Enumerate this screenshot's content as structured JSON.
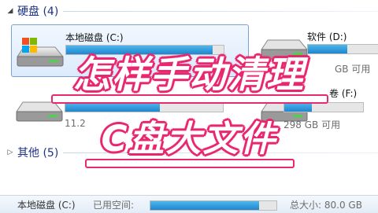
{
  "groups": {
    "hard_disks": {
      "label": "硬盘 (4)"
    },
    "other": {
      "label": "其他 (5)"
    }
  },
  "drives": [
    {
      "name": "本地磁盘 (C:)",
      "free_text": "11.2",
      "used_fraction": 0.93,
      "selected": true
    },
    {
      "name": "软件 (D:)",
      "free_text": "GB 可用",
      "used_fraction": 0.5,
      "selected": false
    },
    {
      "name": "卷 (F:)",
      "free_text": "298 GB 可用",
      "used_fraction": 0.35,
      "selected": false
    },
    {
      "name": "",
      "free_text": "",
      "used_fraction": 0.6,
      "selected": false
    }
  ],
  "overlay": {
    "line1": "怎样手动清理",
    "line2": "C盘大文件",
    "color_outline": "#e8286f"
  },
  "details": {
    "drive": "本地磁盘 (C:)",
    "used_label": "已用空间:",
    "total": "总大小: 80.0 GB",
    "used_fraction": 0.86
  },
  "colors": {
    "bar_fill": "#1f86d0",
    "header": "#1e3287",
    "selection": "#dcebfc"
  }
}
